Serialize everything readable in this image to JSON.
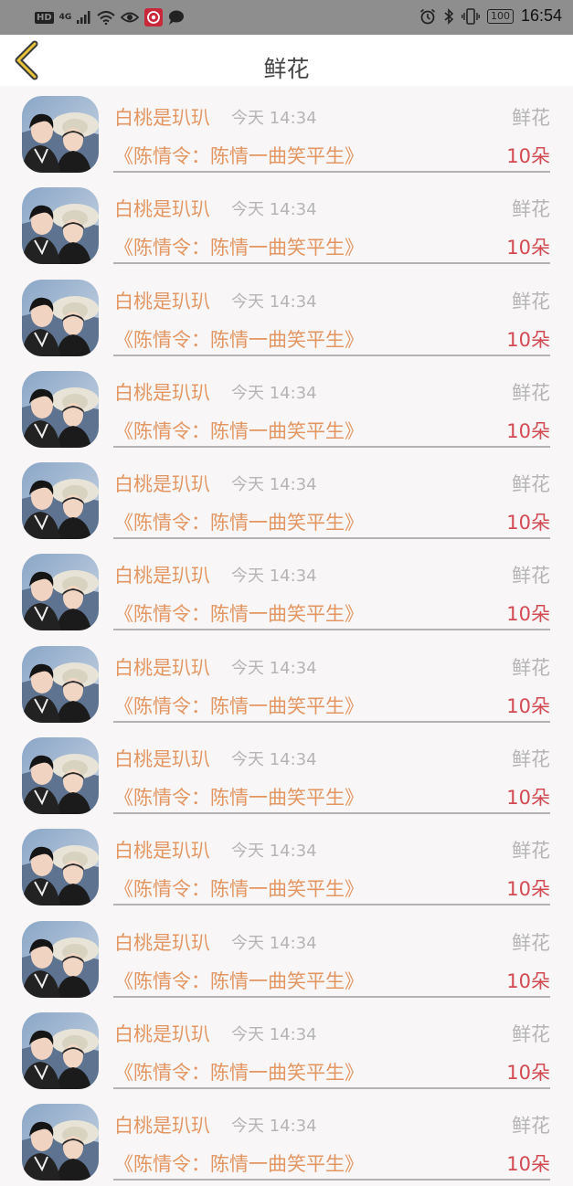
{
  "status_bar": {
    "hd": "HD",
    "network": "4G",
    "time": "16:54",
    "battery": "100"
  },
  "header": {
    "title": "鲜花"
  },
  "colors": {
    "name": "#e39662",
    "count": "#d24a52",
    "muted": "#b5b5b5"
  },
  "records": [
    {
      "name": "白桃是玐玐",
      "time": "今天 14:34",
      "tag": "鲜花",
      "drama": "《陈情令：陈情一曲笑平生》",
      "count": "10朵"
    },
    {
      "name": "白桃是玐玐",
      "time": "今天 14:34",
      "tag": "鲜花",
      "drama": "《陈情令：陈情一曲笑平生》",
      "count": "10朵"
    },
    {
      "name": "白桃是玐玐",
      "time": "今天 14:34",
      "tag": "鲜花",
      "drama": "《陈情令：陈情一曲笑平生》",
      "count": "10朵"
    },
    {
      "name": "白桃是玐玐",
      "time": "今天 14:34",
      "tag": "鲜花",
      "drama": "《陈情令：陈情一曲笑平生》",
      "count": "10朵"
    },
    {
      "name": "白桃是玐玐",
      "time": "今天 14:34",
      "tag": "鲜花",
      "drama": "《陈情令：陈情一曲笑平生》",
      "count": "10朵"
    },
    {
      "name": "白桃是玐玐",
      "time": "今天 14:34",
      "tag": "鲜花",
      "drama": "《陈情令：陈情一曲笑平生》",
      "count": "10朵"
    },
    {
      "name": "白桃是玐玐",
      "time": "今天 14:34",
      "tag": "鲜花",
      "drama": "《陈情令：陈情一曲笑平生》",
      "count": "10朵"
    },
    {
      "name": "白桃是玐玐",
      "time": "今天 14:34",
      "tag": "鲜花",
      "drama": "《陈情令：陈情一曲笑平生》",
      "count": "10朵"
    },
    {
      "name": "白桃是玐玐",
      "time": "今天 14:34",
      "tag": "鲜花",
      "drama": "《陈情令：陈情一曲笑平生》",
      "count": "10朵"
    },
    {
      "name": "白桃是玐玐",
      "time": "今天 14:34",
      "tag": "鲜花",
      "drama": "《陈情令：陈情一曲笑平生》",
      "count": "10朵"
    },
    {
      "name": "白桃是玐玐",
      "time": "今天 14:34",
      "tag": "鲜花",
      "drama": "《陈情令：陈情一曲笑平生》",
      "count": "10朵"
    },
    {
      "name": "白桃是玐玐",
      "time": "今天 14:34",
      "tag": "鲜花",
      "drama": "《陈情令：陈情一曲笑平生》",
      "count": "10朵"
    }
  ]
}
